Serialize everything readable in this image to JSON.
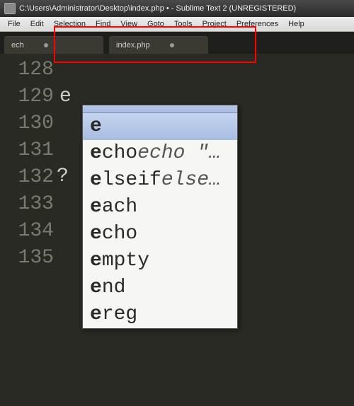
{
  "titlebar": {
    "title": "C:\\Users\\Administrator\\Desktop\\index.php • - Sublime Text 2 (UNREGISTERED)"
  },
  "menubar": {
    "items": [
      "File",
      "Edit",
      "Selection",
      "Find",
      "View",
      "Goto",
      "Tools",
      "Project",
      "Preferences",
      "Help"
    ]
  },
  "tabs": [
    {
      "label": "ech",
      "dirty": true
    },
    {
      "label": "index.php",
      "dirty": true
    }
  ],
  "editor": {
    "lines": [
      "128",
      "129",
      "130",
      "131",
      "132",
      "133",
      "134",
      "135"
    ],
    "typed_char": "e",
    "question_mark": "?"
  },
  "autocomplete": {
    "items": [
      {
        "match": "e",
        "rest": "",
        "hint": "",
        "selected": true
      },
      {
        "match": "e",
        "rest": "cho",
        "hint": "echo \"…",
        "selected": false
      },
      {
        "match": "e",
        "rest": "lseif",
        "hint": "else…",
        "selected": false
      },
      {
        "match": "e",
        "rest": "ach",
        "hint": "",
        "selected": false
      },
      {
        "match": "e",
        "rest": "cho",
        "hint": "",
        "selected": false
      },
      {
        "match": "e",
        "rest": "mpty",
        "hint": "",
        "selected": false
      },
      {
        "match": "e",
        "rest": "nd",
        "hint": "",
        "selected": false
      },
      {
        "match": "e",
        "rest": "reg",
        "hint": "",
        "selected": false
      }
    ]
  }
}
